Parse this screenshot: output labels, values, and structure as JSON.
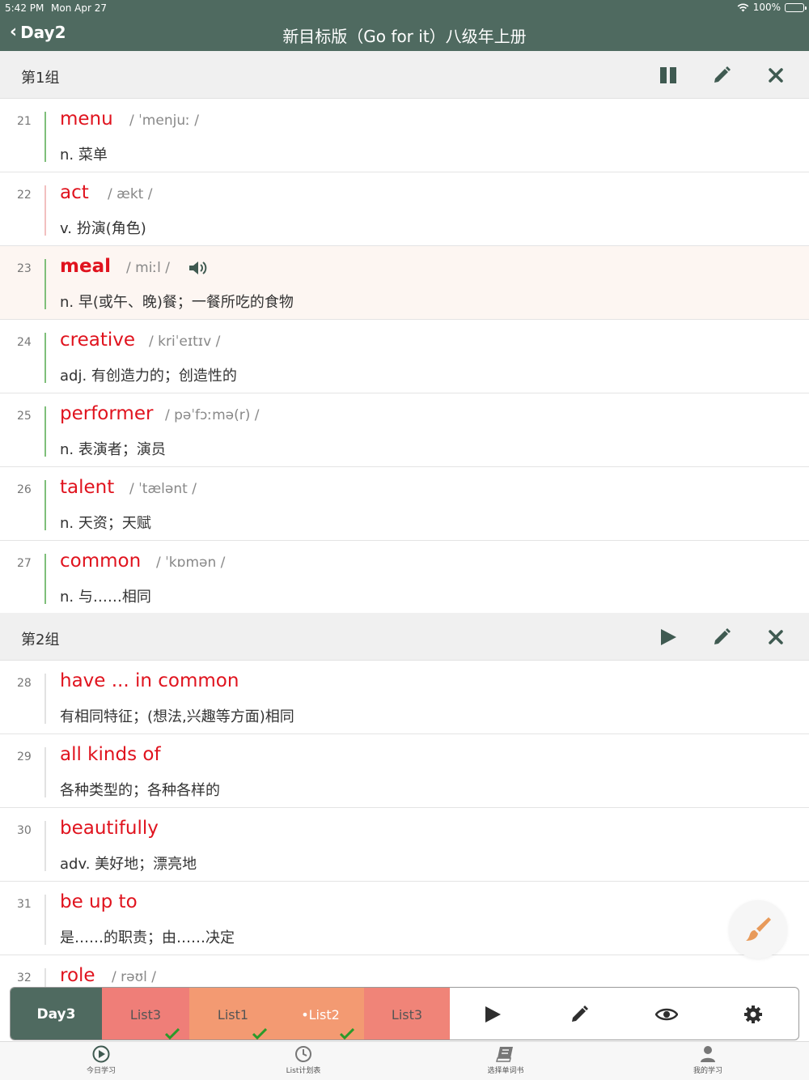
{
  "status": {
    "time": "5:42 PM",
    "date": "Mon Apr 27",
    "battery": "100%"
  },
  "nav": {
    "back_label": "Day2",
    "title": "新目标版（Go for it）八级年上册"
  },
  "groups": [
    {
      "title": "第1组"
    },
    {
      "title": "第2组"
    }
  ],
  "words": [
    {
      "num": "21",
      "word": "menu",
      "phonetic": "/ ˈmenjuː /",
      "definition": "n. 菜单"
    },
    {
      "num": "22",
      "word": "act",
      "phonetic": "/ ækt /",
      "definition": "v. 扮演(角色)"
    },
    {
      "num": "23",
      "word": "meal",
      "phonetic": "/ miːl /",
      "definition": "n. 早(或午、晚)餐；一餐所吃的食物"
    },
    {
      "num": "24",
      "word": "creative",
      "phonetic": "/ kriˈeɪtɪv /",
      "definition": "adj. 有创造力的；创造性的"
    },
    {
      "num": "25",
      "word": "performer",
      "phonetic": "/ pəˈfɔːmə(r) /",
      "definition": "n. 表演者；演员"
    },
    {
      "num": "26",
      "word": "talent",
      "phonetic": "/ ˈtælənt /",
      "definition": "n. 天资；天赋"
    },
    {
      "num": "27",
      "word": "common",
      "phonetic": "/ ˈkɒmən /",
      "definition": "n. 与……相同"
    },
    {
      "num": "28",
      "word": "have ... in common",
      "phonetic": "",
      "definition": " 有相同特征；(想法,兴趣等方面)相同"
    },
    {
      "num": "29",
      "word": "all kinds of",
      "phonetic": "",
      "definition": " 各种类型的；各种各样的"
    },
    {
      "num": "30",
      "word": "beautifully",
      "phonetic": "",
      "definition": "adv. 美好地；漂亮地"
    },
    {
      "num": "31",
      "word": "be up to",
      "phonetic": "",
      "definition": " 是……的职责；由……决定"
    },
    {
      "num": "32",
      "word": "role",
      "phonetic": "/ rəʊl /",
      "definition": ""
    }
  ],
  "toolbar": {
    "day_label": "Day3",
    "lists": [
      {
        "label": "List3",
        "checked": true
      },
      {
        "label": "List1",
        "checked": true
      },
      {
        "label": "•List2",
        "checked": true
      },
      {
        "label": "List3",
        "checked": false
      }
    ]
  },
  "tabs": [
    {
      "label": "今日学习",
      "icon": "play-circle-icon"
    },
    {
      "label": "List计划表",
      "icon": "clock-icon"
    },
    {
      "label": "选择单词书",
      "icon": "book-icon"
    },
    {
      "label": "我的学习",
      "icon": "person-icon"
    }
  ],
  "colors": {
    "header_bg": "#4f6a60",
    "word_red": "#e0131e",
    "bar_green": "#7fbf7a",
    "list_red": "#ef7e78",
    "list_orange": "#f39a72",
    "check_green": "#2a9a2a"
  }
}
